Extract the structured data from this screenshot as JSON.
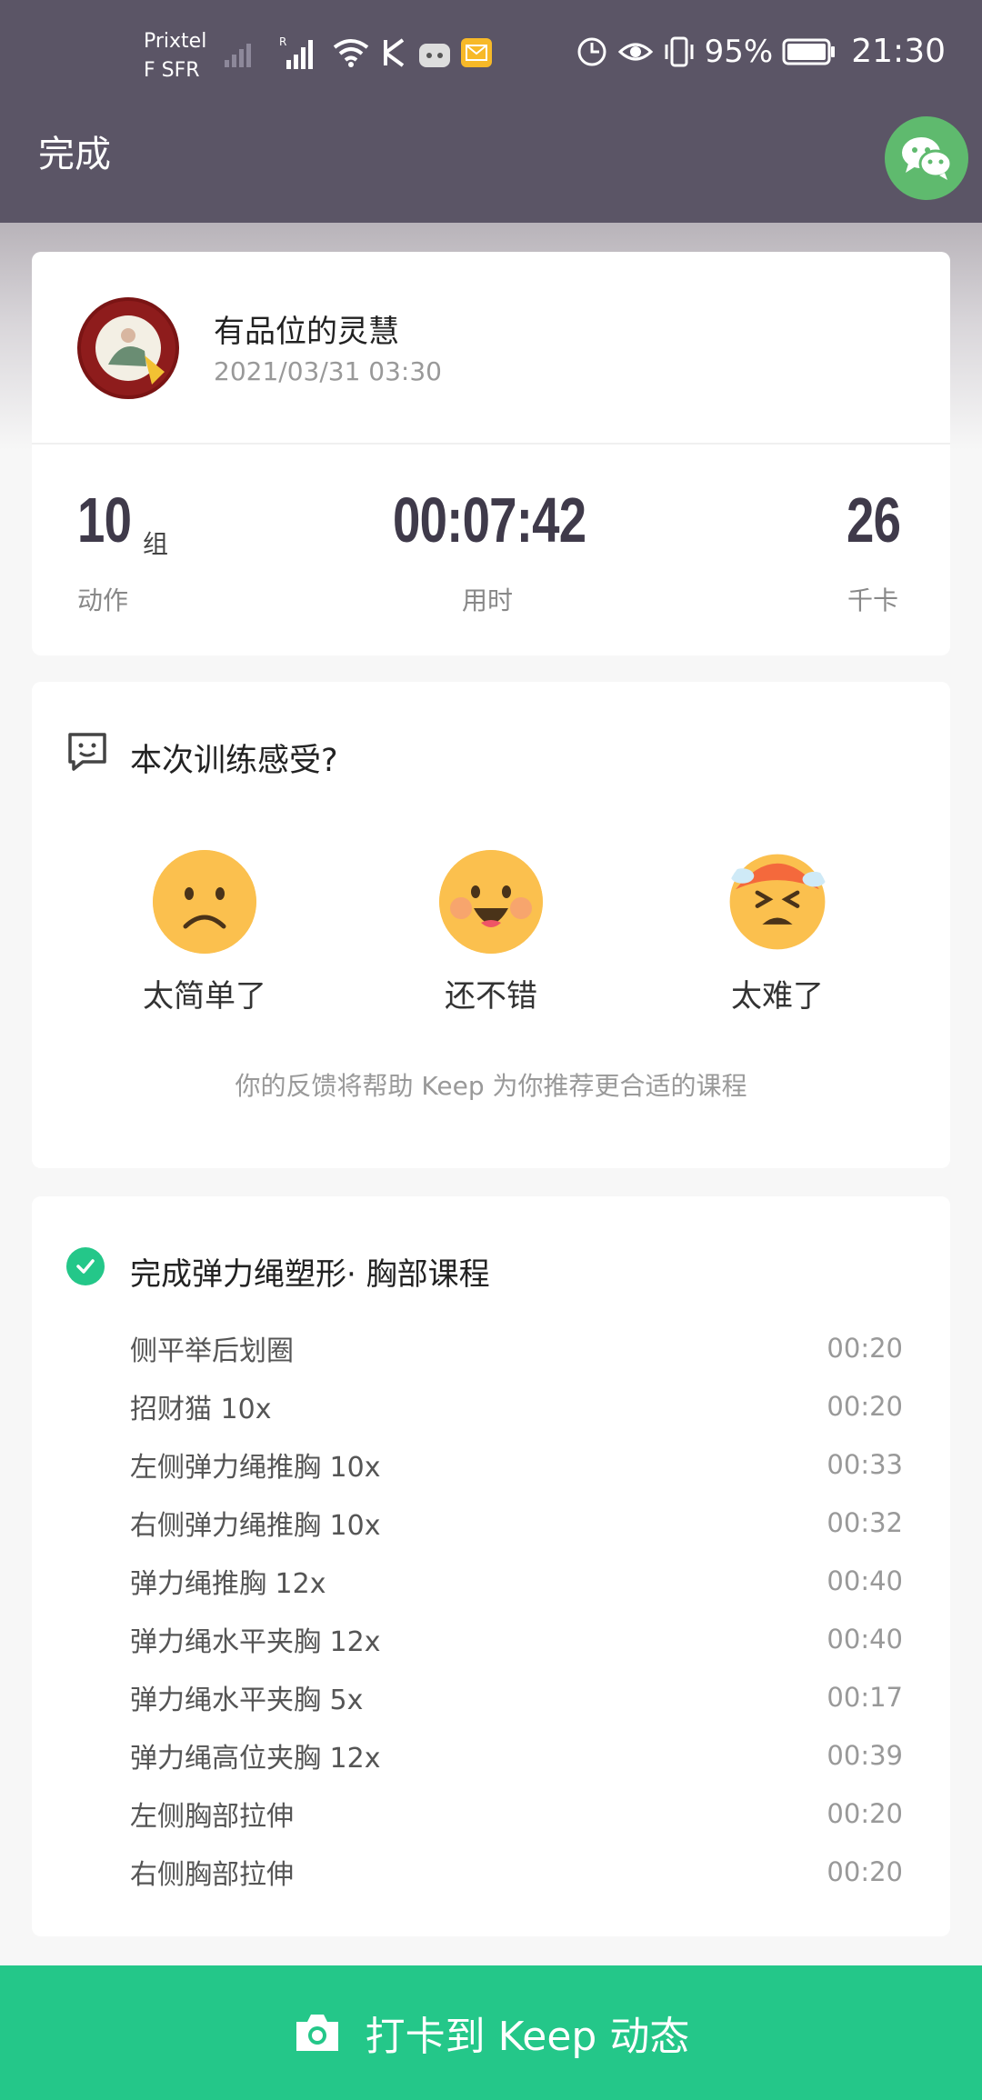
{
  "status_bar": {
    "carrier_line1": "Prixtel",
    "carrier_line2": "F SFR",
    "battery_pct": "95%",
    "time": "21:30"
  },
  "header": {
    "done_label": "完成",
    "share_icon": "wechat-icon"
  },
  "summary": {
    "username": "有品位的灵慧",
    "date": "2021/03/31 03:30",
    "stats": [
      {
        "value": "10",
        "unit": "组",
        "label": "动作"
      },
      {
        "value": "00:07:42",
        "unit": "",
        "label": "用时"
      },
      {
        "value": "26",
        "unit": "",
        "label": "千卡"
      }
    ]
  },
  "feedback": {
    "title": "本次训练感受?",
    "options": [
      {
        "label": "太简单了",
        "icon": "frown-emoji-icon"
      },
      {
        "label": "还不错",
        "icon": "smile-emoji-icon"
      },
      {
        "label": "太难了",
        "icon": "sweat-emoji-icon"
      }
    ],
    "hint": "你的反馈将帮助 Keep 为你推荐更合适的课程"
  },
  "course": {
    "title": "完成弹力绳塑形· 胸部课程",
    "exercises": [
      {
        "name": "侧平举后划圈",
        "time": "00:20"
      },
      {
        "name": "招财猫 10x",
        "time": "00:20"
      },
      {
        "name": "左侧弹力绳推胸 10x",
        "time": "00:33"
      },
      {
        "name": "右侧弹力绳推胸 10x",
        "time": "00:32"
      },
      {
        "name": "弹力绳推胸 12x",
        "time": "00:40"
      },
      {
        "name": "弹力绳水平夹胸 12x",
        "time": "00:40"
      },
      {
        "name": "弹力绳水平夹胸 5x",
        "time": "00:17"
      },
      {
        "name": "弹力绳高位夹胸 12x",
        "time": "00:39"
      },
      {
        "name": "左侧胸部拉伸",
        "time": "00:20"
      },
      {
        "name": "右侧胸部拉伸",
        "time": "00:20"
      }
    ]
  },
  "cta": {
    "label": "打卡到 Keep 动态",
    "icon": "camera-icon"
  },
  "colors": {
    "header": "#5b5566",
    "accent": "#24c789",
    "wechat": "#5fba6e"
  }
}
